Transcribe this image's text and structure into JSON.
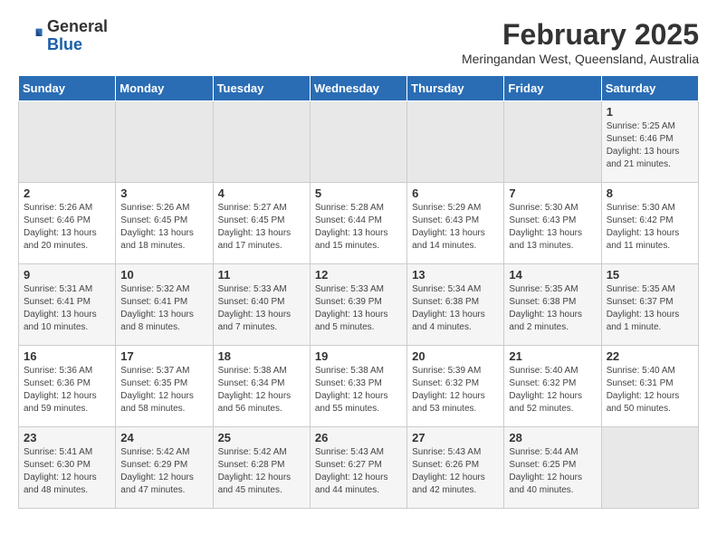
{
  "header": {
    "logo_general": "General",
    "logo_blue": "Blue",
    "month_year": "February 2025",
    "location": "Meringandan West, Queensland, Australia"
  },
  "days_of_week": [
    "Sunday",
    "Monday",
    "Tuesday",
    "Wednesday",
    "Thursday",
    "Friday",
    "Saturday"
  ],
  "weeks": [
    [
      {
        "day": "",
        "info": ""
      },
      {
        "day": "",
        "info": ""
      },
      {
        "day": "",
        "info": ""
      },
      {
        "day": "",
        "info": ""
      },
      {
        "day": "",
        "info": ""
      },
      {
        "day": "",
        "info": ""
      },
      {
        "day": "1",
        "info": "Sunrise: 5:25 AM\nSunset: 6:46 PM\nDaylight: 13 hours\nand 21 minutes."
      }
    ],
    [
      {
        "day": "2",
        "info": "Sunrise: 5:26 AM\nSunset: 6:46 PM\nDaylight: 13 hours\nand 20 minutes."
      },
      {
        "day": "3",
        "info": "Sunrise: 5:26 AM\nSunset: 6:45 PM\nDaylight: 13 hours\nand 18 minutes."
      },
      {
        "day": "4",
        "info": "Sunrise: 5:27 AM\nSunset: 6:45 PM\nDaylight: 13 hours\nand 17 minutes."
      },
      {
        "day": "5",
        "info": "Sunrise: 5:28 AM\nSunset: 6:44 PM\nDaylight: 13 hours\nand 15 minutes."
      },
      {
        "day": "6",
        "info": "Sunrise: 5:29 AM\nSunset: 6:43 PM\nDaylight: 13 hours\nand 14 minutes."
      },
      {
        "day": "7",
        "info": "Sunrise: 5:30 AM\nSunset: 6:43 PM\nDaylight: 13 hours\nand 13 minutes."
      },
      {
        "day": "8",
        "info": "Sunrise: 5:30 AM\nSunset: 6:42 PM\nDaylight: 13 hours\nand 11 minutes."
      }
    ],
    [
      {
        "day": "9",
        "info": "Sunrise: 5:31 AM\nSunset: 6:41 PM\nDaylight: 13 hours\nand 10 minutes."
      },
      {
        "day": "10",
        "info": "Sunrise: 5:32 AM\nSunset: 6:41 PM\nDaylight: 13 hours\nand 8 minutes."
      },
      {
        "day": "11",
        "info": "Sunrise: 5:33 AM\nSunset: 6:40 PM\nDaylight: 13 hours\nand 7 minutes."
      },
      {
        "day": "12",
        "info": "Sunrise: 5:33 AM\nSunset: 6:39 PM\nDaylight: 13 hours\nand 5 minutes."
      },
      {
        "day": "13",
        "info": "Sunrise: 5:34 AM\nSunset: 6:38 PM\nDaylight: 13 hours\nand 4 minutes."
      },
      {
        "day": "14",
        "info": "Sunrise: 5:35 AM\nSunset: 6:38 PM\nDaylight: 13 hours\nand 2 minutes."
      },
      {
        "day": "15",
        "info": "Sunrise: 5:35 AM\nSunset: 6:37 PM\nDaylight: 13 hours\nand 1 minute."
      }
    ],
    [
      {
        "day": "16",
        "info": "Sunrise: 5:36 AM\nSunset: 6:36 PM\nDaylight: 12 hours\nand 59 minutes."
      },
      {
        "day": "17",
        "info": "Sunrise: 5:37 AM\nSunset: 6:35 PM\nDaylight: 12 hours\nand 58 minutes."
      },
      {
        "day": "18",
        "info": "Sunrise: 5:38 AM\nSunset: 6:34 PM\nDaylight: 12 hours\nand 56 minutes."
      },
      {
        "day": "19",
        "info": "Sunrise: 5:38 AM\nSunset: 6:33 PM\nDaylight: 12 hours\nand 55 minutes."
      },
      {
        "day": "20",
        "info": "Sunrise: 5:39 AM\nSunset: 6:32 PM\nDaylight: 12 hours\nand 53 minutes."
      },
      {
        "day": "21",
        "info": "Sunrise: 5:40 AM\nSunset: 6:32 PM\nDaylight: 12 hours\nand 52 minutes."
      },
      {
        "day": "22",
        "info": "Sunrise: 5:40 AM\nSunset: 6:31 PM\nDaylight: 12 hours\nand 50 minutes."
      }
    ],
    [
      {
        "day": "23",
        "info": "Sunrise: 5:41 AM\nSunset: 6:30 PM\nDaylight: 12 hours\nand 48 minutes."
      },
      {
        "day": "24",
        "info": "Sunrise: 5:42 AM\nSunset: 6:29 PM\nDaylight: 12 hours\nand 47 minutes."
      },
      {
        "day": "25",
        "info": "Sunrise: 5:42 AM\nSunset: 6:28 PM\nDaylight: 12 hours\nand 45 minutes."
      },
      {
        "day": "26",
        "info": "Sunrise: 5:43 AM\nSunset: 6:27 PM\nDaylight: 12 hours\nand 44 minutes."
      },
      {
        "day": "27",
        "info": "Sunrise: 5:43 AM\nSunset: 6:26 PM\nDaylight: 12 hours\nand 42 minutes."
      },
      {
        "day": "28",
        "info": "Sunrise: 5:44 AM\nSunset: 6:25 PM\nDaylight: 12 hours\nand 40 minutes."
      },
      {
        "day": "",
        "info": ""
      }
    ]
  ]
}
